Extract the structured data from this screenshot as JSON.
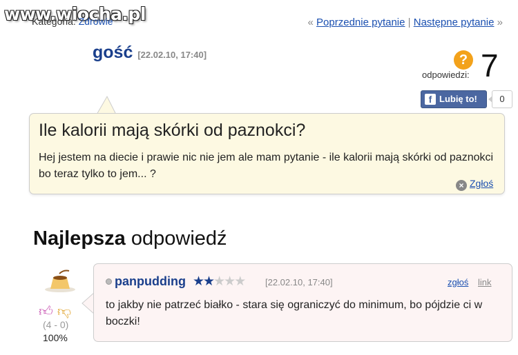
{
  "watermark": "www.wiocha.pl",
  "category": {
    "label": "Kategoria:",
    "value": "Zdrowie"
  },
  "nav": {
    "prev": "Poprzednie pytanie",
    "separator": "|",
    "next": "Następne pytanie",
    "left_arrows": "«",
    "right_arrows": "»"
  },
  "question": {
    "author": "gość",
    "date": "[22.02.10, 17:40]",
    "title": "Ile kalorii mają skórki od paznokci?",
    "body": "Hej jestem na diecie i prawie nic nie jem ale mam pytanie - ile kalorii mają skórki od paznokci bo teraz tylko to jem... ?",
    "report": "Zgłoś"
  },
  "answers": {
    "icon": "?",
    "label": "odpowiedzi:",
    "count": "7"
  },
  "facebook": {
    "icon": "f",
    "like_label": "Lubię to!",
    "count": "0"
  },
  "best_answer": {
    "heading_bold": "Najlepsza",
    "heading_rest": "odpowiedź",
    "author": "panpudding",
    "rating": {
      "filled": 1.5,
      "max": 5
    },
    "date": "[22.02.10, 17:40]",
    "report": "zgłoś",
    "link": "link",
    "body": "to jakby nie patrzeć białko - stara się ograniczyć do minimum, bo pójdzie ci w boczki!",
    "votes": "(4 - 0)",
    "percent": "100%"
  },
  "icons": {
    "avatar": "pudding-avatar",
    "thumb_up": "thumb-up-icon",
    "thumb_down": "thumb-down-icon",
    "close": "close-icon",
    "question": "question-icon"
  },
  "colors": {
    "accent_blue": "#1a3f8c",
    "link": "#1a4fb0",
    "question_bg": "#fdf9e2",
    "answer_bg": "#fdf4f4",
    "facebook": "#4b67a1",
    "orange": "#f3a21b"
  }
}
